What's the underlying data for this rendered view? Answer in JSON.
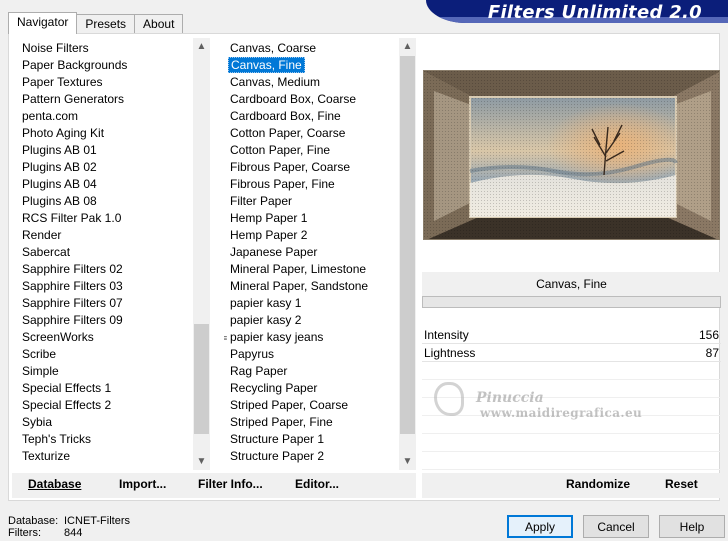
{
  "banner": {
    "title": "Filters Unlimited 2.0"
  },
  "tabs": [
    "Navigator",
    "Presets",
    "About"
  ],
  "categories": [
    "Noise Filters",
    "Paper Backgrounds",
    "Paper Textures",
    "Pattern Generators",
    "penta.com",
    "Photo Aging Kit",
    "Plugins AB 01",
    "Plugins AB 02",
    "Plugins AB 04",
    "Plugins AB 08",
    "RCS Filter Pak 1.0",
    "Render",
    "Sabercat",
    "Sapphire Filters 02",
    "Sapphire Filters 03",
    "Sapphire Filters 07",
    "Sapphire Filters 09",
    "ScreenWorks",
    "Scribe",
    "Simple",
    "Special Effects 1",
    "Special Effects 2",
    "Sybia",
    "Teph's Tricks",
    "Texturize"
  ],
  "filters": [
    "Canvas, Coarse",
    "Canvas, Fine",
    "Canvas, Medium",
    "Cardboard Box, Coarse",
    "Cardboard Box, Fine",
    "Cotton Paper, Coarse",
    "Cotton Paper, Fine",
    "Fibrous Paper, Coarse",
    "Fibrous Paper, Fine",
    "Filter Paper",
    "Hemp Paper 1",
    "Hemp Paper 2",
    "Japanese Paper",
    "Mineral Paper, Limestone",
    "Mineral Paper, Sandstone",
    "papier kasy 1",
    "papier kasy 2",
    "papier kasy jeans",
    "Papyrus",
    "Rag Paper",
    "Recycling Paper",
    "Striped Paper, Coarse",
    "Striped Paper, Fine",
    "Structure Paper 1",
    "Structure Paper 2"
  ],
  "selected_filter": "Canvas, Fine",
  "current_filter_name": "Canvas, Fine",
  "params": [
    {
      "label": "Intensity",
      "value": "156"
    },
    {
      "label": "Lightness",
      "value": "87"
    }
  ],
  "watermark": {
    "signature": "Pinuccia",
    "url": "www.maidiregrafica.eu"
  },
  "left_buttons": {
    "database": "Database",
    "import": "Import...",
    "filter_info": "Filter Info...",
    "editor": "Editor..."
  },
  "right_buttons": {
    "randomize": "Randomize",
    "reset": "Reset"
  },
  "status": {
    "database_label": "Database:",
    "database_value": "ICNET-Filters",
    "filters_label": "Filters:",
    "filters_value": "844"
  },
  "dialog": {
    "apply": "Apply",
    "cancel": "Cancel",
    "help": "Help"
  }
}
